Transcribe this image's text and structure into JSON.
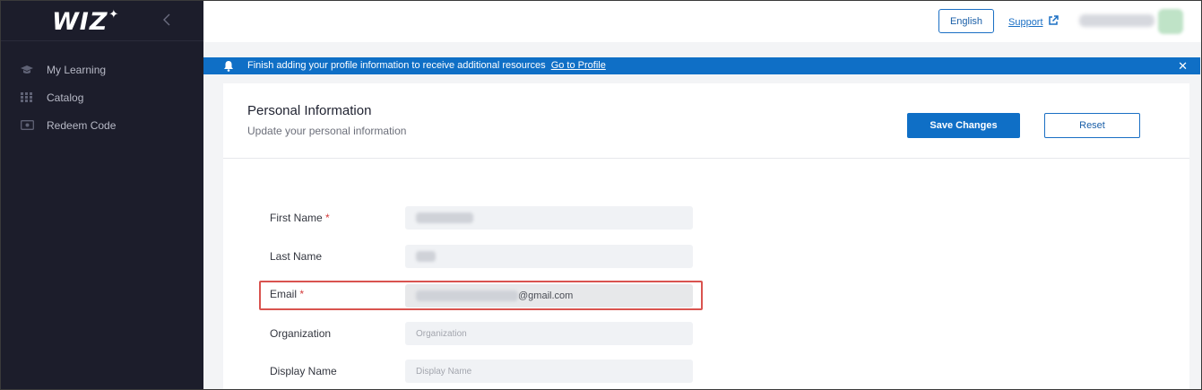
{
  "app": {
    "logo_text": "WIZ",
    "logo_star": "✦"
  },
  "sidebar": {
    "items": [
      {
        "label": "My Learning",
        "icon": "graduation-cap-icon"
      },
      {
        "label": "Catalog",
        "icon": "grid-icon"
      },
      {
        "label": "Redeem Code",
        "icon": "ticket-icon"
      }
    ]
  },
  "topbar": {
    "language_label": "English",
    "support_label": "Support"
  },
  "banner": {
    "message": "Finish adding your profile information to receive additional resources",
    "link_label": "Go to Profile",
    "close_label": "✕"
  },
  "form": {
    "title": "Personal Information",
    "subtitle": "Update your personal information",
    "save_label": "Save Changes",
    "reset_label": "Reset",
    "fields": {
      "first_name": {
        "label": "First Name",
        "required_mark": "*"
      },
      "last_name": {
        "label": "Last Name"
      },
      "email": {
        "label": "Email",
        "required_mark": "*",
        "value_suffix": "@gmail.com"
      },
      "organization": {
        "label": "Organization",
        "placeholder": "Organization"
      },
      "display_name": {
        "label": "Display Name",
        "placeholder": "Display Name"
      }
    }
  },
  "colors": {
    "sidebar_bg": "#1c1d2b",
    "brand_blue": "#0f6fc6",
    "highlight_red": "#d9534f"
  }
}
